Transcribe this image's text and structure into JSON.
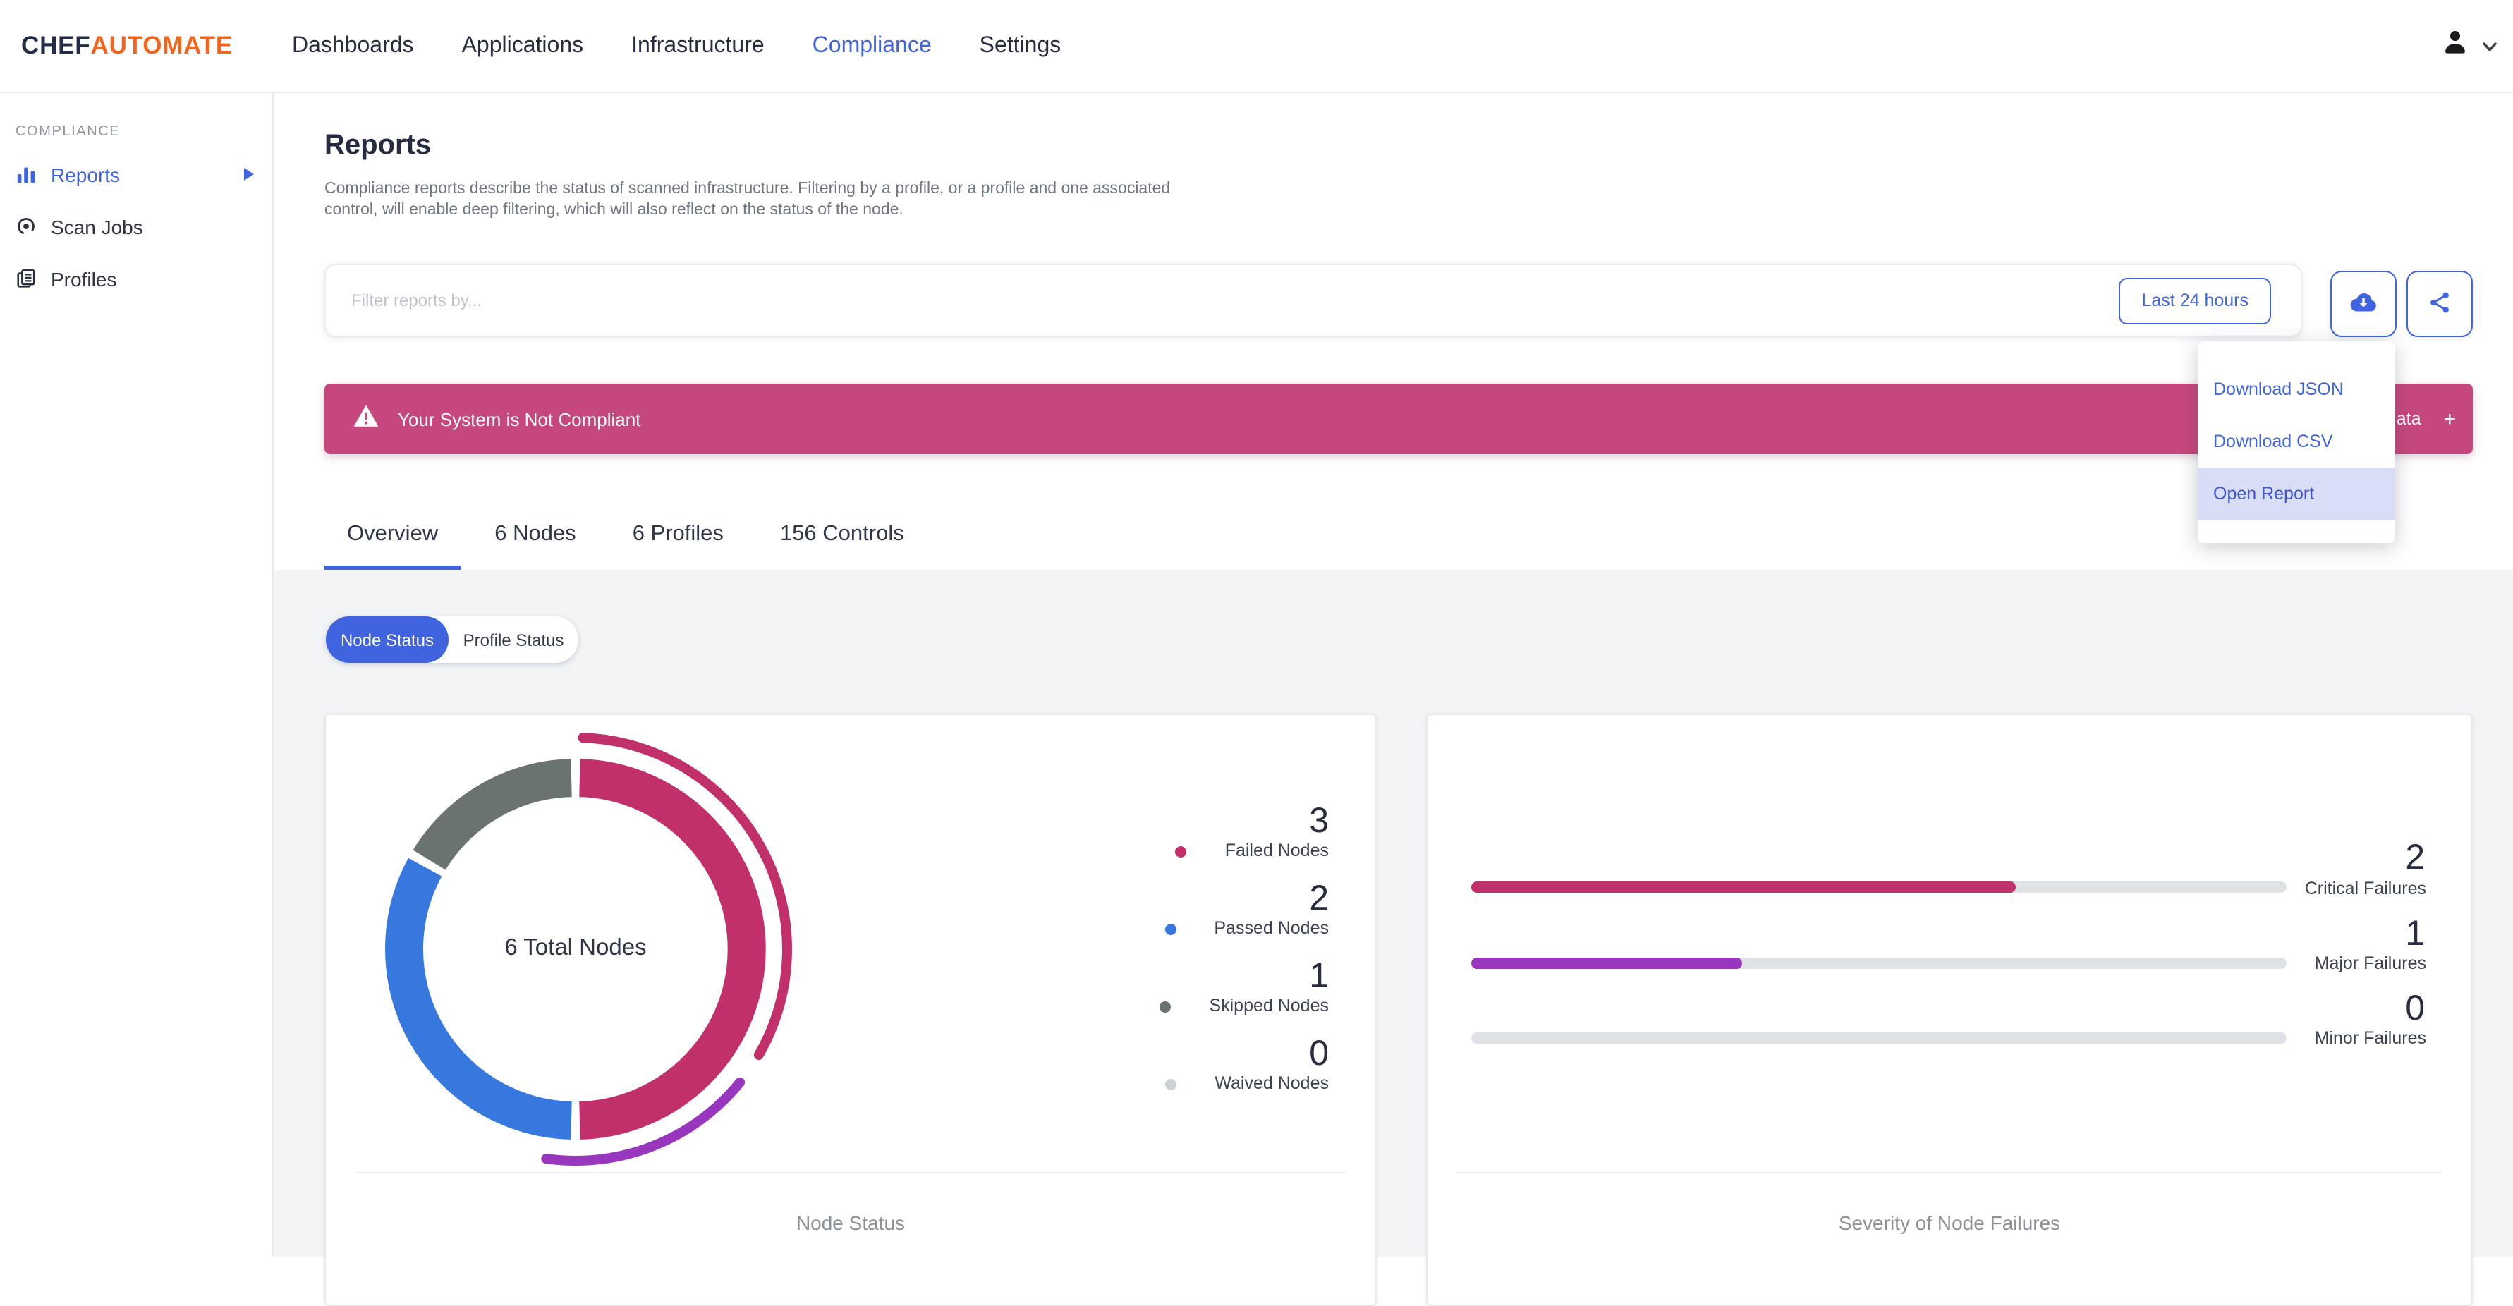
{
  "brand": {
    "chef": "CHEF",
    "automate": "AUTOMATE"
  },
  "nav": {
    "items": [
      {
        "label": "Dashboards",
        "active": false
      },
      {
        "label": "Applications",
        "active": false
      },
      {
        "label": "Infrastructure",
        "active": false
      },
      {
        "label": "Compliance",
        "active": true
      },
      {
        "label": "Settings",
        "active": false
      }
    ]
  },
  "sidebar": {
    "section": "COMPLIANCE",
    "items": [
      {
        "label": "Reports",
        "icon": "bar-chart-icon",
        "active": true,
        "has_submenu": true
      },
      {
        "label": "Scan Jobs",
        "icon": "scan-icon",
        "active": false
      },
      {
        "label": "Profiles",
        "icon": "profiles-icon",
        "active": false
      }
    ]
  },
  "page": {
    "title": "Reports",
    "description": "Compliance reports describe the status of scanned infrastructure. Filtering by a profile, or a profile and one associated control, will enable deep filtering, which will also reflect on the status of the node."
  },
  "filter": {
    "placeholder": "Filter reports by...",
    "time_range_label": "Last 24 hours"
  },
  "toolbar": {
    "download_icon": "cloud-download-icon",
    "share_icon": "share-icon"
  },
  "download_menu": {
    "items": [
      {
        "label": "Download JSON",
        "highlighted": false
      },
      {
        "label": "Download CSV",
        "highlighted": false
      },
      {
        "label": "Open Report",
        "highlighted": true
      }
    ]
  },
  "banner": {
    "message": "Your System is Not Compliant",
    "right_label": "Report Metadata",
    "plus": "+"
  },
  "tabs": [
    {
      "label": "Overview",
      "active": true
    },
    {
      "label": "6 Nodes",
      "active": false
    },
    {
      "label": "6 Profiles",
      "active": false
    },
    {
      "label": "156 Controls",
      "active": false
    }
  ],
  "status_toggle": [
    {
      "label": "Node Status",
      "active": true
    },
    {
      "label": "Profile Status",
      "active": false
    }
  ],
  "chart_data": [
    {
      "type": "donut",
      "title": "Node Status",
      "center_label": "6 Total Nodes",
      "total": 6,
      "legend_position": "right",
      "segments": [
        {
          "label": "Failed Nodes",
          "value": 3,
          "color": "#C2306C"
        },
        {
          "label": "Passed Nodes",
          "value": 2,
          "color": "#3778DF"
        },
        {
          "label": "Skipped Nodes",
          "value": 1,
          "color": "#6B7370"
        },
        {
          "label": "Waived Nodes",
          "value": 0,
          "color": "#CBD3D9"
        }
      ],
      "outer_arcs": [
        {
          "label": "Critical",
          "value": 2,
          "color": "#C2306C"
        },
        {
          "label": "Major",
          "value": 1,
          "color": "#9836BE"
        }
      ]
    },
    {
      "type": "bar",
      "orientation": "horizontal",
      "title": "Severity of Node Failures",
      "max": 3,
      "track_color": "#DEE2E7",
      "bars": [
        {
          "label": "Critical Failures",
          "value": 2,
          "color": "#C2306C"
        },
        {
          "label": "Major Failures",
          "value": 1,
          "color": "#9836BE"
        },
        {
          "label": "Minor Failures",
          "value": 0,
          "color": "#DEE2E7"
        }
      ]
    }
  ],
  "colors": {
    "primary_blue": "#4064E0",
    "banner_pink": "#C6477D",
    "chart_pink": "#C2306C",
    "chart_blue": "#3778DF",
    "chart_purple": "#9836BE",
    "skipped_gray": "#6B7370",
    "waived_gray": "#CBD3D9",
    "brand_orange": "#F1661F",
    "page_background": "#F2F4F6"
  }
}
